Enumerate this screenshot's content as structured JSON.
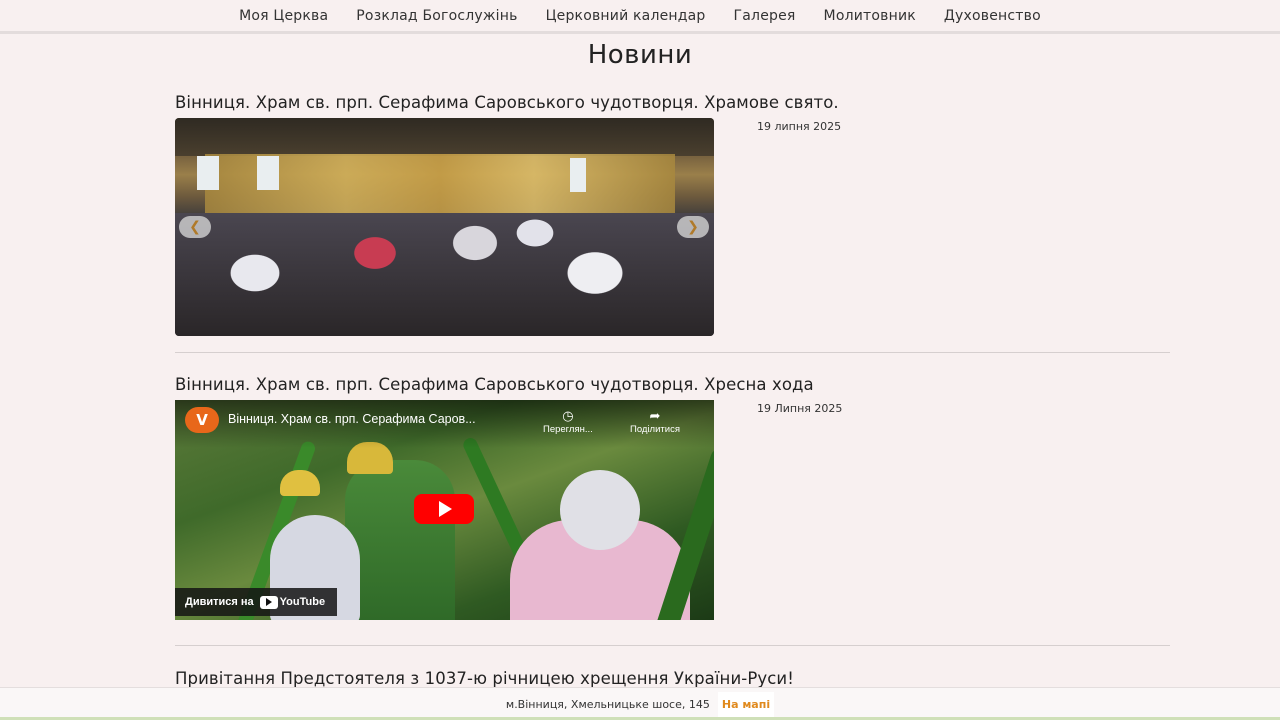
{
  "nav": {
    "items": [
      {
        "label": "Моя Церква"
      },
      {
        "label": "Розклад Богослужінь"
      },
      {
        "label": "Церковний календар"
      },
      {
        "label": "Галерея"
      },
      {
        "label": "Молитовник"
      },
      {
        "label": "Духовенство"
      }
    ]
  },
  "page": {
    "title": "Новини"
  },
  "news": [
    {
      "title": "Вінниця. Храм св. прп. Серафима Саровського чудотворця. Храмове свято.",
      "date": "19 липня 2025",
      "media": "photo-carousel"
    },
    {
      "title": "Вінниця. Храм св. прп. Серафима Саровського чудотворця. Хресна хода",
      "date": "19 Липня 2025",
      "media": "youtube-video",
      "video": {
        "channel_initial": "V",
        "title": "Вінниця. Храм св. прп. Серафима Саров...",
        "watch_later": "Переглян...",
        "share": "Поділитися",
        "watch_on": "Дивитися на",
        "platform": "YouTube"
      }
    },
    {
      "title": "Привітання Предстоятеля з 1037-ю річницею хрещення України-Руси!"
    }
  ],
  "carousel": {
    "prev_icon": "chevron-left-icon",
    "next_icon": "chevron-right-icon"
  },
  "footer": {
    "address": "м.Вінниця, Хмельницьке шосе, 145",
    "map_link": "На мапі"
  },
  "colors": {
    "background": "#f8f0f0",
    "accent": "#e08a1e",
    "youtube_red": "#ff0000"
  }
}
